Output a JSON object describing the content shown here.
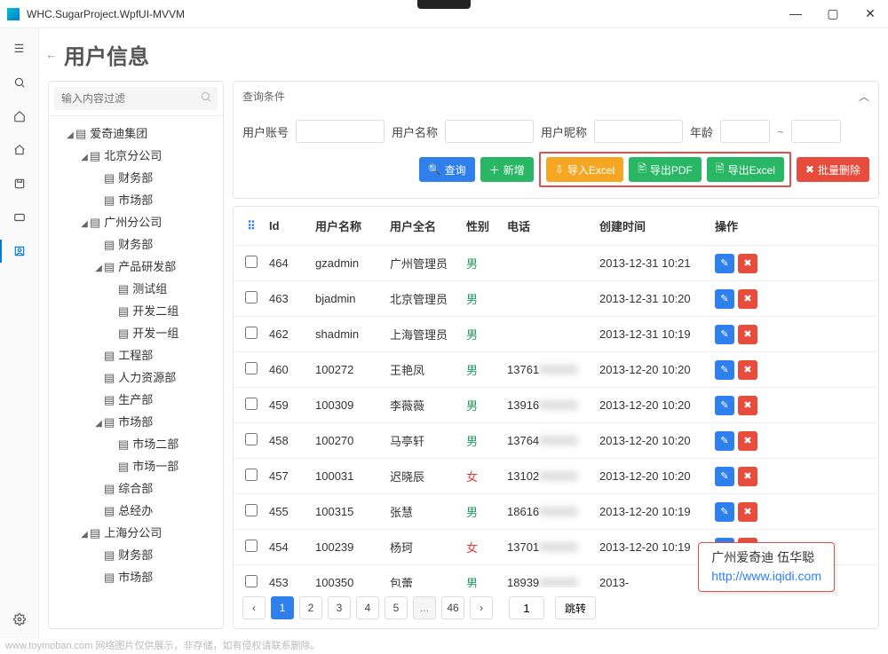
{
  "window": {
    "title": "WHC.SugarProject.WpfUI-MVVM"
  },
  "page": {
    "title": "用户信息"
  },
  "tree_search": {
    "placeholder": "输入内容过滤"
  },
  "tree": [
    {
      "level": 1,
      "expand": true,
      "label": "爱奇迪集团"
    },
    {
      "level": 2,
      "expand": true,
      "label": "北京分公司"
    },
    {
      "level": 3,
      "label": "财务部"
    },
    {
      "level": 3,
      "label": "市场部"
    },
    {
      "level": 2,
      "expand": true,
      "label": "广州分公司"
    },
    {
      "level": 3,
      "label": "财务部"
    },
    {
      "level": 3,
      "expand": true,
      "label": "产品研发部"
    },
    {
      "level": 4,
      "label": "测试组"
    },
    {
      "level": 4,
      "label": "开发二组"
    },
    {
      "level": 4,
      "label": "开发一组"
    },
    {
      "level": 3,
      "label": "工程部"
    },
    {
      "level": 3,
      "label": "人力资源部"
    },
    {
      "level": 3,
      "label": "生产部"
    },
    {
      "level": 3,
      "expand": true,
      "label": "市场部"
    },
    {
      "level": 4,
      "label": "市场二部"
    },
    {
      "level": 4,
      "label": "市场一部"
    },
    {
      "level": 3,
      "label": "综合部"
    },
    {
      "level": 3,
      "label": "总经办"
    },
    {
      "level": 2,
      "expand": true,
      "label": "上海分公司"
    },
    {
      "level": 3,
      "label": "财务部"
    },
    {
      "level": 3,
      "label": "市场部"
    }
  ],
  "filter": {
    "title": "查询条件",
    "fields": {
      "account": "用户账号",
      "name": "用户名称",
      "nick": "用户昵称",
      "age": "年龄"
    },
    "buttons": {
      "search": "查询",
      "add": "新增",
      "import": "导入Excel",
      "exportPdf": "导出PDF",
      "exportExcel": "导出Excel",
      "batchDel": "批量删除"
    }
  },
  "table": {
    "headers": {
      "id": "Id",
      "uname": "用户名称",
      "fname": "用户全名",
      "sex": "性别",
      "phone": "电话",
      "time": "创建时间",
      "op": "操作"
    },
    "rows": [
      {
        "id": "464",
        "uname": "gzadmin",
        "fname": "广州管理员",
        "sex": "男",
        "phone": "",
        "time": "2013-12-31 10:21"
      },
      {
        "id": "463",
        "uname": "bjadmin",
        "fname": "北京管理员",
        "sex": "男",
        "phone": "",
        "time": "2013-12-31 10:20"
      },
      {
        "id": "462",
        "uname": "shadmin",
        "fname": "上海管理员",
        "sex": "男",
        "phone": "",
        "time": "2013-12-31 10:19"
      },
      {
        "id": "460",
        "uname": "100272",
        "fname": "王艳凤",
        "sex": "男",
        "phone": "13761",
        "time": "2013-12-20 10:20"
      },
      {
        "id": "459",
        "uname": "100309",
        "fname": "李薇薇",
        "sex": "男",
        "phone": "13916",
        "time": "2013-12-20 10:20"
      },
      {
        "id": "458",
        "uname": "100270",
        "fname": "马亭轩",
        "sex": "男",
        "phone": "13764",
        "time": "2013-12-20 10:20"
      },
      {
        "id": "457",
        "uname": "100031",
        "fname": "迟晓辰",
        "sex": "女",
        "phone": "13102",
        "time": "2013-12-20 10:20"
      },
      {
        "id": "455",
        "uname": "100315",
        "fname": "张慧",
        "sex": "男",
        "phone": "18616",
        "time": "2013-12-20 10:19"
      },
      {
        "id": "454",
        "uname": "100239",
        "fname": "杨珂",
        "sex": "女",
        "phone": "13701",
        "time": "2013-12-20 10:19"
      },
      {
        "id": "453",
        "uname": "100350",
        "fname": "包蕾",
        "sex": "男",
        "phone": "18939",
        "time": "2013-"
      }
    ]
  },
  "pager": {
    "pages": [
      "1",
      "2",
      "3",
      "4",
      "5",
      "...",
      "46"
    ],
    "active": "1",
    "jump": "跳转"
  },
  "callout": {
    "line1": "广州爱奇迪 伍华聪",
    "line2": "http://www.iqidi.com"
  },
  "footer": "www.toymoban.com 网络图片仅供展示，非存储，如有侵权请联系删除。"
}
